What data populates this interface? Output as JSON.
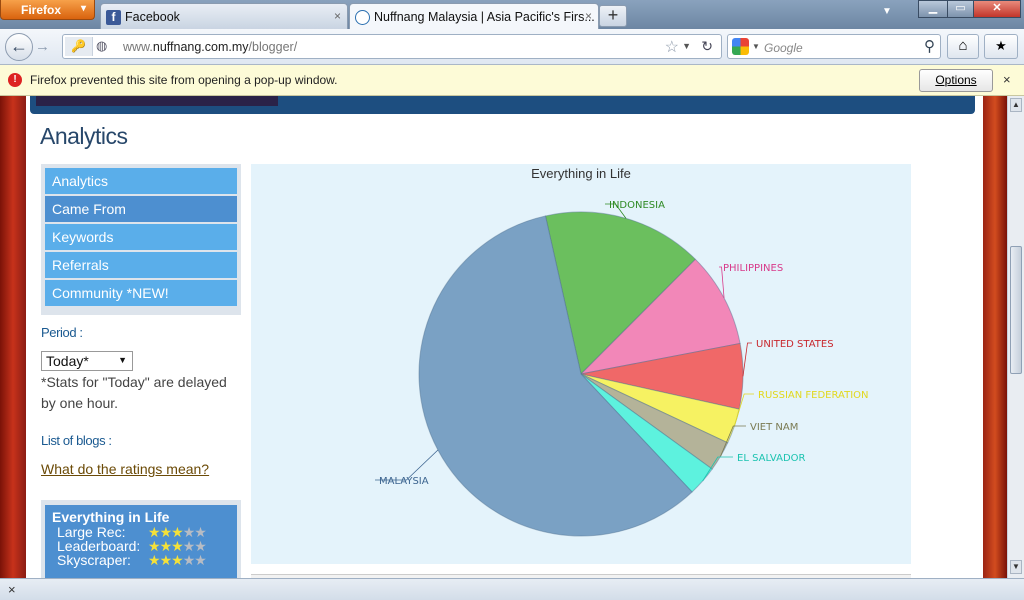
{
  "browser": {
    "menu_button": "Firefox",
    "tabs": [
      {
        "title": "Facebook",
        "icon": "facebook-icon",
        "close": "×"
      },
      {
        "title": "Nuffnang Malaysia | Asia Pacific's Firs...",
        "icon": "nuffnang-icon",
        "close": "×"
      }
    ],
    "new_tab": "+",
    "window_controls": {
      "minimize": "▁",
      "maximize": "▭",
      "close": "✕"
    },
    "nav": {
      "back": "←",
      "forward": "→",
      "url_prefix": "www.",
      "url_domain": "nuffnang.com.my",
      "url_path": "/blogger/",
      "search_placeholder": "Google",
      "home": "⌂",
      "bookmarks": "★"
    },
    "notification": {
      "text": "Firefox prevented this site from opening a pop-up window.",
      "options": "Options",
      "close": "×"
    },
    "addon_bar_close": "×"
  },
  "page": {
    "title": "Analytics",
    "sidebar": {
      "items": [
        {
          "label": "Analytics"
        },
        {
          "label": "Came From"
        },
        {
          "label": "Keywords"
        },
        {
          "label": "Referrals"
        },
        {
          "label": "Community *NEW!"
        }
      ]
    },
    "period_label": "Period :",
    "period_value": "Today*",
    "stats_note": "*Stats for \"Today\" are delayed by one hour.",
    "blogs_label": "List of blogs :",
    "ratings_link": "What do the ratings mean?",
    "rating_box": {
      "title": "Everything in Life",
      "rows": [
        {
          "label": "Large Rec:",
          "stars": 3,
          "max": 5
        },
        {
          "label": "Leaderboard:",
          "stars": 3,
          "max": 5
        },
        {
          "label": "Skyscraper:",
          "stars": 3,
          "max": 5
        }
      ]
    }
  },
  "colors": {
    "malaysia": "#7aa1c4",
    "indonesia": "#6bbf5e",
    "philippines": "#f287b8",
    "united_states": "#f06868",
    "russian_federation": "#f6f262",
    "viet_nam": "#b4b399",
    "el_salvador": "#5df2de"
  },
  "chart_data": {
    "type": "pie",
    "title": "Everything in Life",
    "slices": [
      {
        "label": "INDONESIA",
        "value": 16,
        "color": "#6bbf5e",
        "label_color": "#2f8a24"
      },
      {
        "label": "PHILIPPINES",
        "value": 9.5,
        "color": "#f287b8",
        "label_color": "#d8398a"
      },
      {
        "label": "UNITED STATES",
        "value": 6.5,
        "color": "#f06868",
        "label_color": "#c8282e"
      },
      {
        "label": "RUSSIAN FEDERATION",
        "value": 3.5,
        "color": "#f6f262",
        "label_color": "#e2d81e"
      },
      {
        "label": "VIET NAM",
        "value": 3,
        "color": "#b4b399",
        "label_color": "#7a7a52"
      },
      {
        "label": "EL SALVADOR",
        "value": 3,
        "color": "#5df2de",
        "label_color": "#1cc3b0"
      },
      {
        "label": "MALAYSIA",
        "value": 58.5,
        "color": "#7aa1c4",
        "label_color": "#3d6590"
      }
    ]
  }
}
